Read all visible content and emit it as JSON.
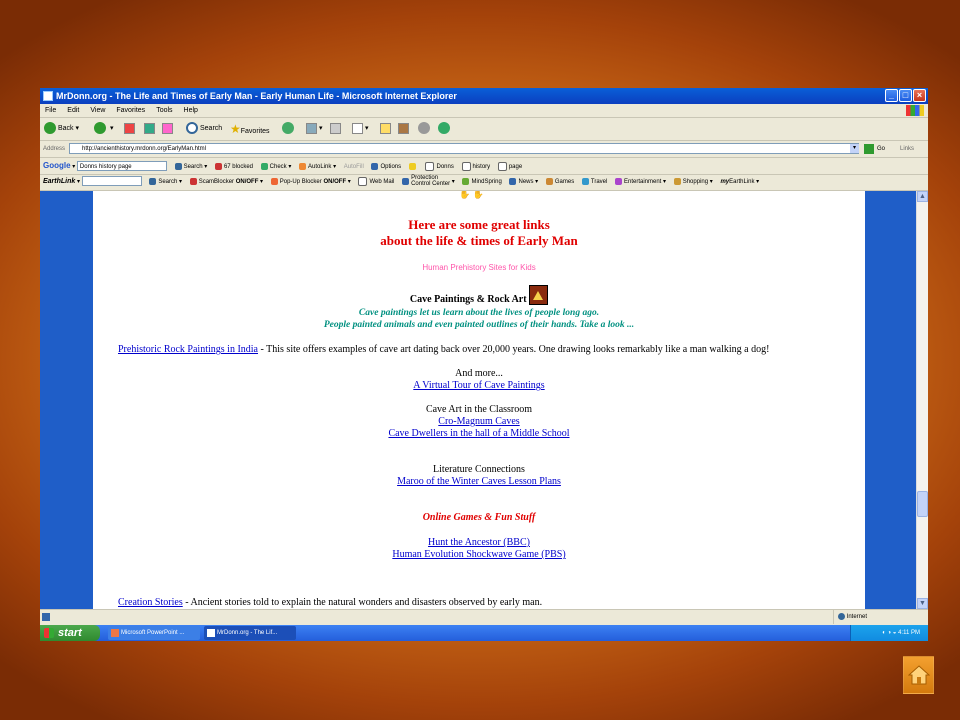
{
  "window": {
    "title": "MrDonn.org - The Life and Times of Early Man - Early Human Life - Microsoft Internet Explorer",
    "min": "_",
    "max": "□",
    "close": "×"
  },
  "menu": [
    "File",
    "Edit",
    "View",
    "Favorites",
    "Tools",
    "Help"
  ],
  "toolbar": {
    "back": "Back",
    "search": "Search",
    "favorites": "Favorites"
  },
  "address": {
    "label": "Address",
    "url": "http://ancienthistory.mrdonn.org/EarlyMan.html",
    "go": "Go",
    "links": "Links"
  },
  "google_bar": {
    "brand": "Google",
    "query": "Donns history page",
    "search": "Search",
    "blocked": "67 blocked",
    "check": "Check",
    "autolink": "AutoLink",
    "autofill": "AutoFill",
    "options": "Options",
    "donns": "Donns",
    "history": "history",
    "page": "page"
  },
  "earthlink_bar": {
    "brand": "EarthLink",
    "search": "Search",
    "scamblocker": "ScamBlocker",
    "scam_state": "ON/OFF",
    "popup": "Pop-Up Blocker",
    "popup_state": "ON/OFF",
    "webmail": "Web Mail",
    "protection": "Protection",
    "protection2": "Control Center",
    "mindspring": "MindSpring",
    "news": "News",
    "games": "Games",
    "travel": "Travel",
    "entertainment": "Entertainment",
    "shopping": "Shopping",
    "earthlink": "EarthLink"
  },
  "content": {
    "heading1": "Here are some great links",
    "heading2": "about the life & times of Early Man",
    "subtitle": "Human Prehistory Sites for Kids",
    "cave_heading": "Cave Paintings & Rock Art",
    "cave_text1": "Cave paintings let us learn about the lives of people long ago.",
    "cave_text2": "People painted animals and even painted outlines of their hands. Take a look ...",
    "rock_link": "Prehistoric Rock Paintings in India",
    "rock_text": " - This site offers examples of cave art dating back over 20,000 years. One drawing looks remarkably like a man walking a dog!",
    "and_more": "And more...",
    "virtual_tour": "A Virtual Tour of Cave Paintings",
    "classroom": "Cave Art in the Classroom",
    "cromagnum": "Cro-Magnum Caves",
    "cave_dwellers": "Cave Dwellers in the hall of a Middle School",
    "literature": "Literature Connections",
    "maroo": "Maroo of the Winter Caves Lesson Plans",
    "games_heading": "Online Games & Fun Stuff",
    "hunt": "Hunt the Ancestor (BBC)",
    "human_evo": "Human Evolution Shockwave Game (PBS)",
    "creation_link": "Creation Stories",
    "creation_text": " - Ancient stories told to explain the natural wonders and disasters observed by early man."
  },
  "status": {
    "zone": "Internet"
  },
  "taskbar": {
    "start": "start",
    "tasks": [
      "Microsoft PowerPoint ...",
      "MrDonn.org - The Lif..."
    ],
    "clock": "4:11 PM"
  },
  "colors": {
    "titlebar": "#0b4fd0",
    "page_bg": "#1f5ec8",
    "heading": "#e00000",
    "link": "#0000cc",
    "teal": "#009080",
    "slide_bg": "#d9781c"
  },
  "icons": [
    "home-icon",
    "back-icon",
    "forward-icon",
    "stop-icon",
    "refresh-icon",
    "search-icon",
    "favorites-icon"
  ]
}
